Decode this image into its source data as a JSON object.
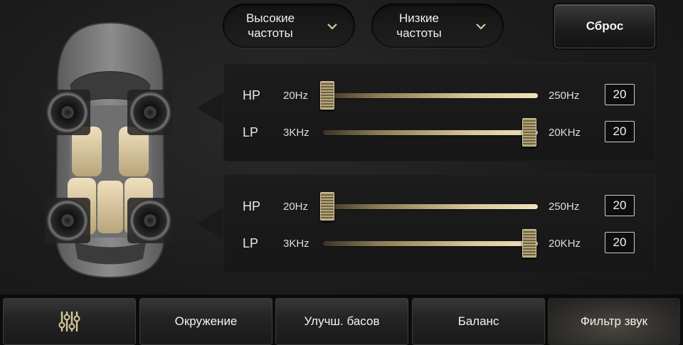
{
  "header": {
    "high_freq_label": "Высокие частоты",
    "low_freq_label": "Низкие частоты",
    "reset_label": "Сброс"
  },
  "front": {
    "hp": {
      "tag": "HP",
      "min_label": "20Hz",
      "max_label": "250Hz",
      "value": "20",
      "level": 0.02
    },
    "lp": {
      "tag": "LP",
      "min_label": "3KHz",
      "max_label": "20KHz",
      "value": "20",
      "level": 0.96
    }
  },
  "rear": {
    "hp": {
      "tag": "HP",
      "min_label": "20Hz",
      "max_label": "250Hz",
      "value": "20",
      "level": 0.02
    },
    "lp": {
      "tag": "LP",
      "min_label": "3KHz",
      "max_label": "20KHz",
      "value": "20",
      "level": 0.96
    }
  },
  "tabs": [
    {
      "label": "",
      "icon": "equalizer-icon"
    },
    {
      "label": "Окружение"
    },
    {
      "label": "Улучш. басов"
    },
    {
      "label": "Баланс"
    },
    {
      "label": "Фильтр звук",
      "active": true
    }
  ],
  "colors": {
    "accent_gold": "#d8c89a",
    "background": "#1b1b1b"
  }
}
